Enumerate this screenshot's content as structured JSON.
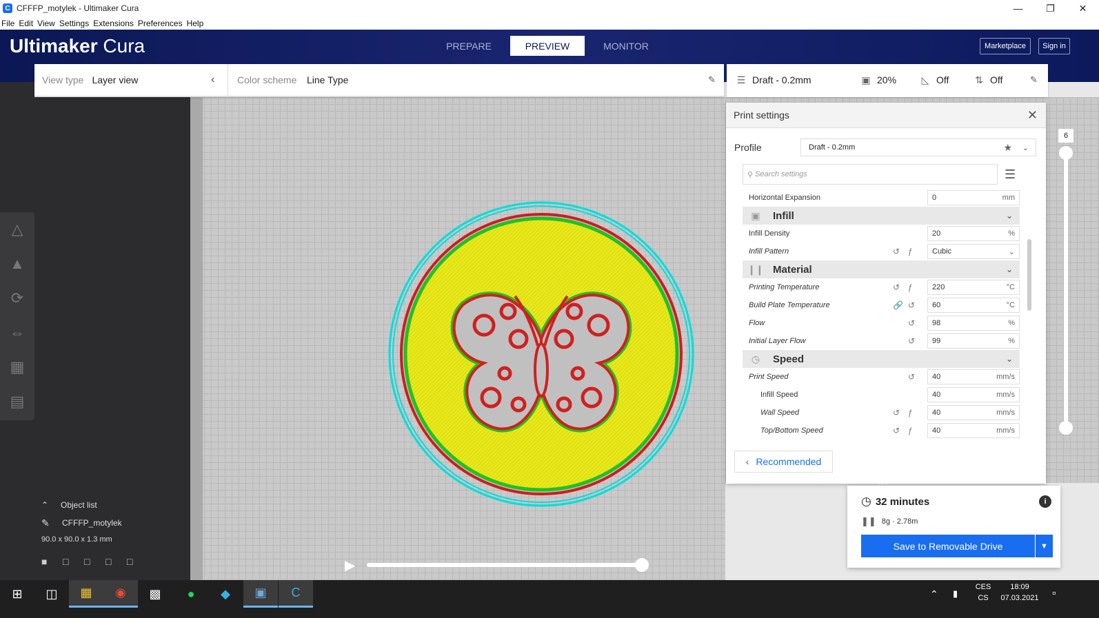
{
  "window": {
    "title": "CFFFP_motylek - Ultimaker Cura",
    "icon": "cura-app-icon"
  },
  "menu": [
    "File",
    "Edit",
    "View",
    "Settings",
    "Extensions",
    "Preferences",
    "Help"
  ],
  "header": {
    "logo_bold": "Ultimaker",
    "logo_light": " Cura",
    "tabs": [
      {
        "label": "PREPARE",
        "active": false
      },
      {
        "label": "PREVIEW",
        "active": true
      },
      {
        "label": "MONITOR",
        "active": false
      }
    ],
    "marketplace_label": "Marketplace",
    "signin_label": "Sign in"
  },
  "viewbar": {
    "view_type_label": "View type",
    "view_type_value": "Layer view",
    "color_scheme_label": "Color scheme",
    "color_scheme_value": "Line Type"
  },
  "printbar": {
    "profile": "Draft - 0.2mm",
    "infill": "20%",
    "support": "Off",
    "adhesion": "Off"
  },
  "print_settings": {
    "title": "Print settings",
    "profile_label": "Profile",
    "profile_value": "Draft - 0.2mm",
    "search_placeholder": "Search settings",
    "rows": [
      {
        "type": "setting",
        "label": "Horizontal Expansion",
        "value": "0",
        "unit": "mm",
        "italic": false,
        "sub": false
      },
      {
        "type": "category",
        "label": "Infill",
        "icon": "infill-icon"
      },
      {
        "type": "setting",
        "label": "Infill Density",
        "value": "20",
        "unit": "%",
        "italic": false,
        "sub": false
      },
      {
        "type": "setting",
        "label": "Infill Pattern",
        "value": "Cubic",
        "unit": "",
        "italic": true,
        "sub": false,
        "dropdown": true,
        "reset": true,
        "func": true
      },
      {
        "type": "category",
        "label": "Material",
        "icon": "material-icon"
      },
      {
        "type": "setting",
        "label": "Printing Temperature",
        "value": "220",
        "unit": "°C",
        "italic": true,
        "sub": false,
        "reset": true,
        "func": true
      },
      {
        "type": "setting",
        "label": "Build Plate Temperature",
        "value": "60",
        "unit": "°C",
        "italic": true,
        "sub": false,
        "link": true,
        "reset2": true
      },
      {
        "type": "setting",
        "label": "Flow",
        "value": "98",
        "unit": "%",
        "italic": true,
        "sub": false,
        "reset2": true
      },
      {
        "type": "setting",
        "label": "Initial Layer Flow",
        "value": "99",
        "unit": "%",
        "italic": true,
        "sub": false,
        "reset2": true
      },
      {
        "type": "category",
        "label": "Speed",
        "icon": "speed-icon"
      },
      {
        "type": "setting",
        "label": "Print Speed",
        "value": "40",
        "unit": "mm/s",
        "italic": true,
        "sub": false,
        "reset2": true
      },
      {
        "type": "setting",
        "label": "Infill Speed",
        "value": "40",
        "unit": "mm/s",
        "italic": false,
        "sub": true
      },
      {
        "type": "setting",
        "label": "Wall Speed",
        "value": "40",
        "unit": "mm/s",
        "italic": true,
        "sub": true,
        "reset": true,
        "func": true
      },
      {
        "type": "setting",
        "label": "Top/Bottom Speed",
        "value": "40",
        "unit": "mm/s",
        "italic": true,
        "sub": true,
        "reset": true,
        "func": true
      }
    ],
    "recommended_label": "Recommended"
  },
  "output": {
    "time": "32 minutes",
    "material": "8g · 2.78m",
    "save_label": "Save to Removable Drive"
  },
  "object_list": {
    "title": "Object list",
    "object_name": "CFFFP_motylek",
    "dimensions": "90.0 x 90.0 x 1.3 mm"
  },
  "layer_slider": {
    "top_value": "6"
  },
  "taskbar": {
    "lang_top": "CES",
    "lang_bottom": "CS",
    "time": "18:09",
    "date": "07.03.2021"
  },
  "colors": {
    "accent": "#196ef0",
    "header": "#0b1855",
    "shell": "#00e5e5",
    "wall": "#e01e1e",
    "inner_wall": "#22c022",
    "infill": "#e8e81a"
  }
}
